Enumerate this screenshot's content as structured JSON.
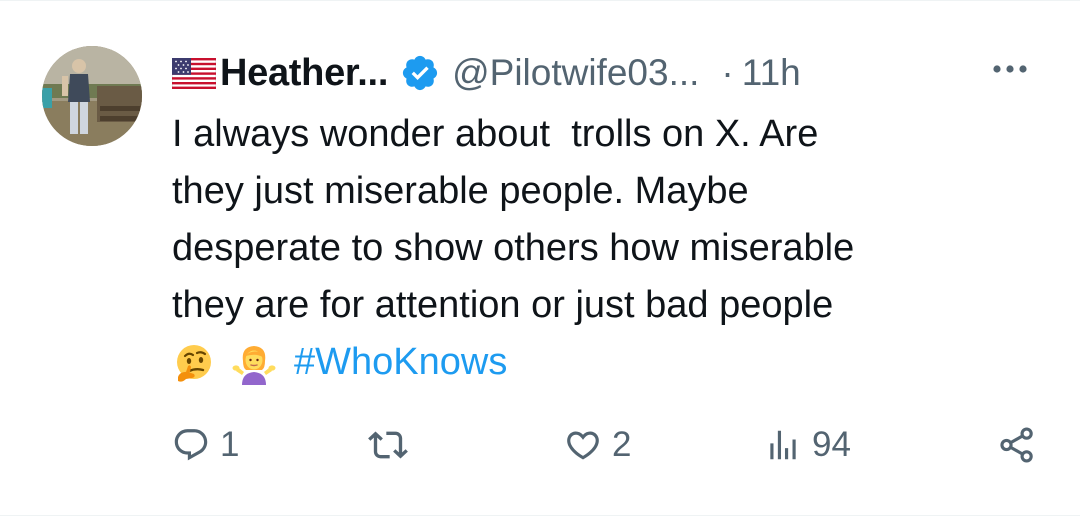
{
  "tweet": {
    "author_name": "Heather...",
    "handle": "@Pilotwife03...",
    "separator": "·",
    "time": "11h",
    "text_lines": [
      "I always wonder about  trolls on X. Are",
      "they just miserable people. Maybe",
      "desperate to show others how miserable",
      "they are for attention or just bad people"
    ],
    "emojis": [
      "thinking-face",
      "person-shrugging"
    ],
    "hashtag": "#WhoKnows"
  },
  "actions": {
    "replies": "1",
    "retweets": "",
    "likes": "2",
    "views": "94"
  },
  "colors": {
    "accent": "#1d9bf0",
    "text": "#0f1419",
    "secondary": "#536471"
  },
  "icons": {
    "flag": "us-flag-icon",
    "verified": "verified-badge-icon",
    "more": "more-dots-icon",
    "reply": "reply-icon",
    "retweet": "retweet-icon",
    "like": "heart-icon",
    "views": "views-bar-icon",
    "share": "share-icon"
  }
}
